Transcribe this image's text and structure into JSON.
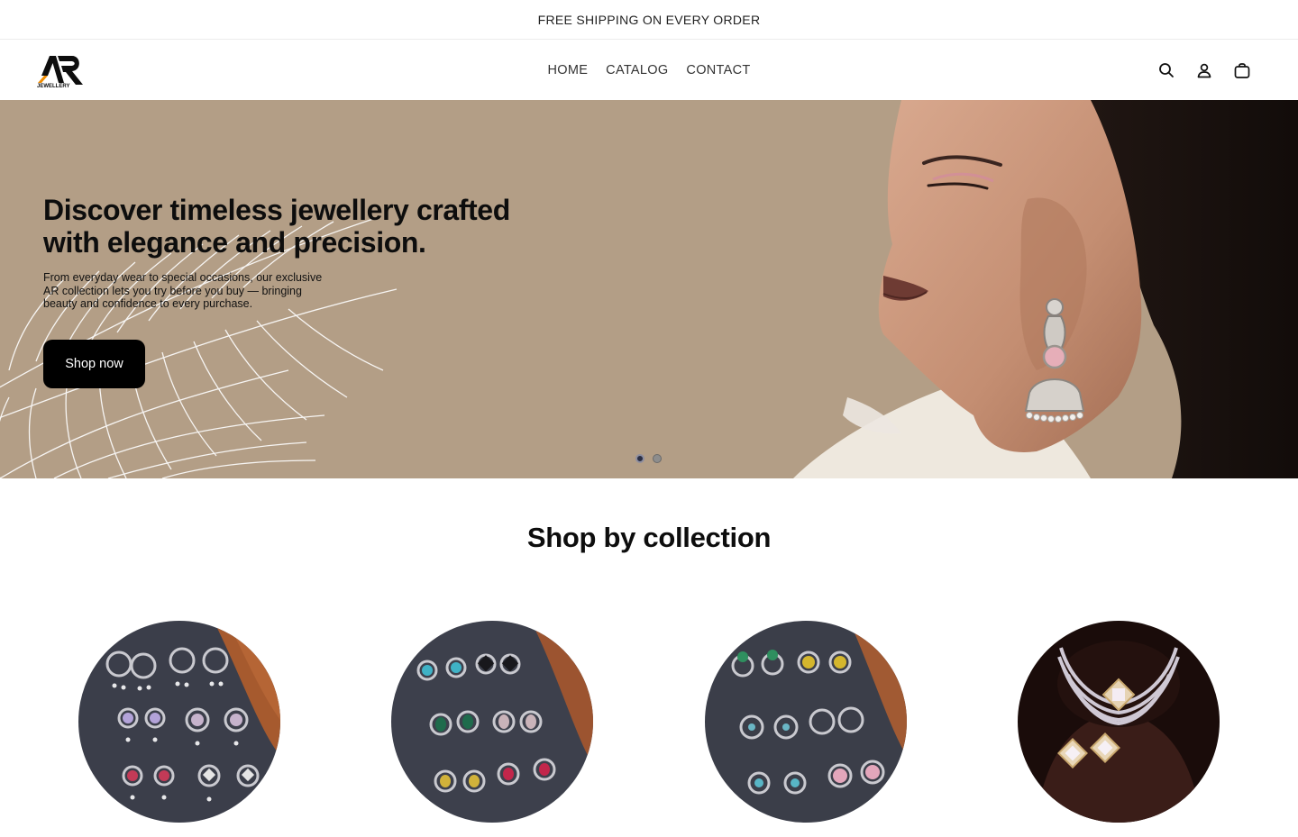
{
  "announcement": {
    "text": "FREE SHIPPING ON EVERY ORDER"
  },
  "header": {
    "logo": {
      "text": "AR",
      "subtext": "JEWELLERY",
      "accent": "#f08c00"
    },
    "nav": [
      {
        "label": "HOME"
      },
      {
        "label": "CATALOG"
      },
      {
        "label": "CONTACT"
      }
    ],
    "icons": [
      "search-icon",
      "account-icon",
      "cart-icon"
    ]
  },
  "hero": {
    "title": "Discover timeless jewellery crafted with elegance and precision.",
    "subtitle": "From everyday wear to special occasions, our exclusive AR collection lets you try before you buy — bringing beauty and confidence to every purchase.",
    "button_label": "Shop now",
    "background_color": "#b39e86",
    "slides_total": 2,
    "active_slide": 1
  },
  "collections": {
    "title": "Shop by collection",
    "items": [
      {
        "image": "earrings-set-purple-pink"
      },
      {
        "image": "earrings-set-teal-green-yellow"
      },
      {
        "image": "earrings-set-green-yellow-pink"
      },
      {
        "image": "kundan-choker-necklace-set"
      }
    ]
  }
}
